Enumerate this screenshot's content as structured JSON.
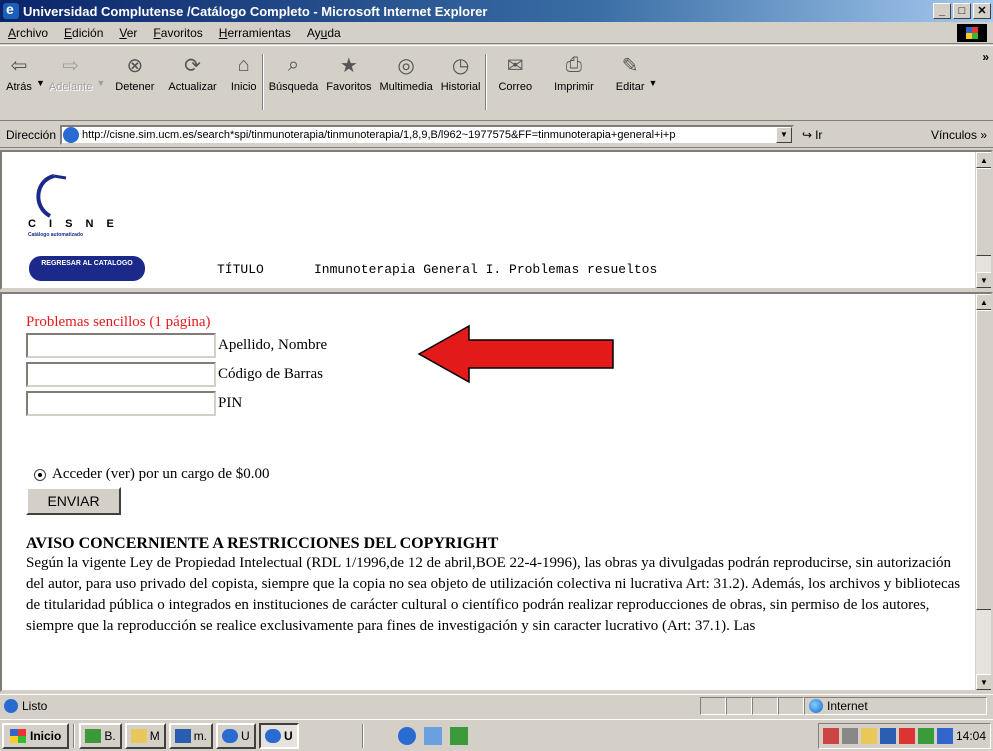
{
  "window": {
    "title": "Universidad Complutense /Catálogo Completo - Microsoft Internet Explorer"
  },
  "menu": [
    "Archivo",
    "Edición",
    "Ver",
    "Favoritos",
    "Herramientas",
    "Ayuda"
  ],
  "menu_accel": [
    "A",
    "E",
    "V",
    "F",
    "H",
    "u"
  ],
  "toolbar": {
    "back": "Atrás",
    "forward": "Adelante",
    "stop": "Detener",
    "refresh": "Actualizar",
    "home": "Inicio",
    "search": "Búsqueda",
    "favorites": "Favoritos",
    "media": "Multimedia",
    "history": "Historial",
    "mail": "Correo",
    "print": "Imprimir",
    "edit": "Editar"
  },
  "address": {
    "label": "Dirección",
    "url": "http://cisne.sim.ucm.es/search*spi/tinmunoterapia/tinmunoterapia/1,8,9,B/l962~1977575&FF=tinmunoterapia+general+i+p",
    "go": "Ir",
    "links": "Vínculos"
  },
  "top_frame": {
    "logo_text": "C I S N E",
    "logo_sub": "Catálogo automatizado",
    "back_button": "REGRESAR AL CATALOGO",
    "title_label": "TÍTULO",
    "title_value": "Inmunoterapia General I. Problemas resueltos"
  },
  "form": {
    "heading": "Problemas sencillos (1 página)",
    "fields": [
      {
        "label": "Apellido, Nombre",
        "value": ""
      },
      {
        "label": "Código de Barras",
        "value": ""
      },
      {
        "label": "PIN",
        "value": ""
      }
    ],
    "radio_label": "Acceder (ver) por un cargo de $0.00",
    "submit": "ENVIAR"
  },
  "copyright": {
    "heading": "AVISO CONCERNIENTE A RESTRICCIONES DEL COPYRIGHT",
    "text": "Según la vigente Ley de Propiedad Intelectual (RDL 1/1996,de 12 de abril,BOE 22-4-1996), las obras ya divulgadas podrán reproducirse, sin autorización del autor, para uso privado del copista, siempre que la copia no sea objeto de utilización colectiva ni lucrativa Art: 31.2). Además, los archivos y bibliotecas de titularidad pública o integrados en instituciones de carácter cultural o científico podrán realizar reproducciones de obras, sin permiso de los autores, siempre que la reproducción se realice exclusivamente para fines de investigación y sin caracter lucrativo (Art: 37.1). Las"
  },
  "status": {
    "text": "Listo",
    "zone": "Internet"
  },
  "taskbar": {
    "start": "Inicio",
    "items": [
      "B.",
      "M",
      "m.",
      "U",
      "U"
    ],
    "clock": "14:04"
  },
  "colors": {
    "accent_red": "#e31a1a",
    "cisne_blue": "#1b2a8a",
    "title_blue": "#0a246a"
  }
}
